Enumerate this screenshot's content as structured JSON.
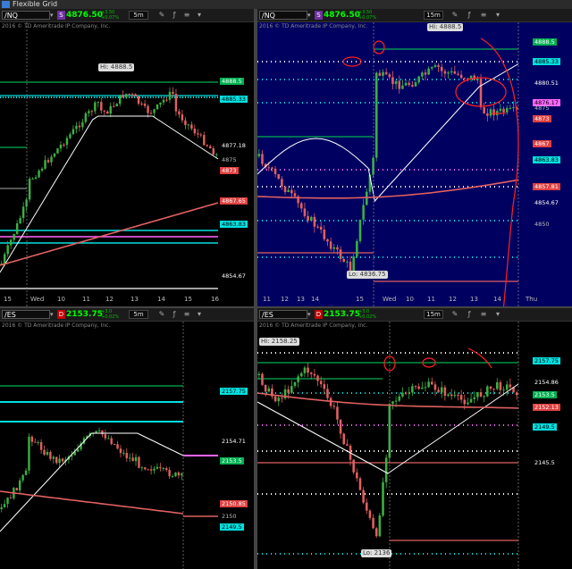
{
  "window": {
    "title": "Flexible Grid"
  },
  "panels": [
    {
      "symbol": "/NQ",
      "last": "4876.50",
      "change": [
        "+3.50",
        "+0.07%"
      ],
      "timeframe": "5m",
      "copyright": "2016 © TD Ameritrade IP Company, Inc.",
      "hi_label": "Hi: 4888.5",
      "price_labels": [
        {
          "text": "4888.5",
          "bg": "#00b050",
          "fg": "#ffffff"
        },
        {
          "text": "4885.33",
          "bg": "#00e0e0",
          "fg": "#000000"
        },
        {
          "text": "4877.18",
          "bg": "",
          "fg": "#ffffff"
        },
        {
          "text": "4875",
          "bg": "",
          "fg": "#bbbbbb"
        },
        {
          "text": "4873",
          "bg": "#e04040",
          "fg": "#ffffff"
        },
        {
          "text": "4867.65",
          "bg": "#e04040",
          "fg": "#ffffff"
        },
        {
          "text": "4863.83",
          "bg": "#00e0e0",
          "fg": "#000000"
        },
        {
          "text": "4854.67",
          "bg": "",
          "fg": "#ffffff"
        }
      ],
      "time_ticks": [
        "15",
        "Wed",
        "10",
        "11",
        "12",
        "13",
        "14",
        "15",
        "16"
      ]
    },
    {
      "symbol": "/NQ",
      "last": "4876.50",
      "change": [
        "+3.50",
        "+0.07%"
      ],
      "timeframe": "15m",
      "copyright": "2016 © TD Ameritrade IP Company, Inc.",
      "hi_label": "Hi: 4888.5",
      "lo_label": "Lo: 4836.75",
      "price_labels": [
        {
          "text": "4888.5",
          "bg": "#00b050",
          "fg": "#ffffff"
        },
        {
          "text": "4885.33",
          "bg": "#00e0e0",
          "fg": "#000000"
        },
        {
          "text": "4880.51",
          "bg": "",
          "fg": "#ffffff"
        },
        {
          "text": "4876.17",
          "bg": "#ff66ff",
          "fg": "#000000"
        },
        {
          "text": "4875",
          "bg": "",
          "fg": "#bbbbbb"
        },
        {
          "text": "4873",
          "bg": "#e04040",
          "fg": "#ffffff"
        },
        {
          "text": "4867",
          "bg": "#e04040",
          "fg": "#ffffff"
        },
        {
          "text": "4863.83",
          "bg": "#00e0e0",
          "fg": "#000000"
        },
        {
          "text": "4857.81",
          "bg": "#e04040",
          "fg": "#ffffff"
        },
        {
          "text": "4854.67",
          "bg": "",
          "fg": "#ffffff"
        },
        {
          "text": "4850",
          "bg": "",
          "fg": "#bbbbbb"
        }
      ],
      "time_ticks": [
        "11",
        "12",
        "13",
        "14",
        "15",
        "Wed",
        "10",
        "11",
        "12",
        "13",
        "14",
        "Thu"
      ]
    },
    {
      "symbol": "/ES",
      "last": "2153.75",
      "change": [
        "+3.0",
        "+0.02%"
      ],
      "timeframe": "5m",
      "copyright": "2016 © TD Ameritrade IP Company, Inc.",
      "price_labels": [
        {
          "text": "2157.75",
          "bg": "#00e0e0",
          "fg": "#000000"
        },
        {
          "text": "2154.71",
          "bg": "",
          "fg": "#ffffff"
        },
        {
          "text": "2153.5",
          "bg": "#00b050",
          "fg": "#ffffff"
        },
        {
          "text": "2150.85",
          "bg": "#e04040",
          "fg": "#ffffff"
        },
        {
          "text": "2150",
          "bg": "",
          "fg": "#bbbbbb"
        },
        {
          "text": "2149.5",
          "bg": "#00e0e0",
          "fg": "#000000"
        }
      ],
      "time_ticks": []
    },
    {
      "symbol": "/ES",
      "last": "2153.75",
      "change": [
        "+3.0",
        "+0.02%"
      ],
      "timeframe": "15m",
      "copyright": "2016 © TD Ameritrade IP Company, Inc.",
      "hi_label": "Hi: 2158.25",
      "lo_label": "Lo: 2136",
      "price_labels": [
        {
          "text": "2157.75",
          "bg": "#00e0e0",
          "fg": "#000000"
        },
        {
          "text": "2154.86",
          "bg": "",
          "fg": "#ffffff"
        },
        {
          "text": "2153.5",
          "bg": "#00b050",
          "fg": "#ffffff"
        },
        {
          "text": "2152.13",
          "bg": "#e04040",
          "fg": "#ffffff"
        },
        {
          "text": "2149.5",
          "bg": "#00e0e0",
          "fg": "#000000"
        },
        {
          "text": "2145.5",
          "bg": "",
          "fg": "#ffffff"
        }
      ],
      "time_ticks": []
    }
  ],
  "colors": {
    "up": "#3cb043",
    "down": "#e06060",
    "sma_fast": "#ffffff",
    "sma_slow": "#e06060",
    "level_cyan": "#00e0e0",
    "level_magenta": "#ff66ff",
    "level_green": "#00b050",
    "level_white": "#ffffff",
    "annotation": "#ff2020",
    "chart_bg_blue": "#000060",
    "chart_bg_black": "#000000"
  }
}
